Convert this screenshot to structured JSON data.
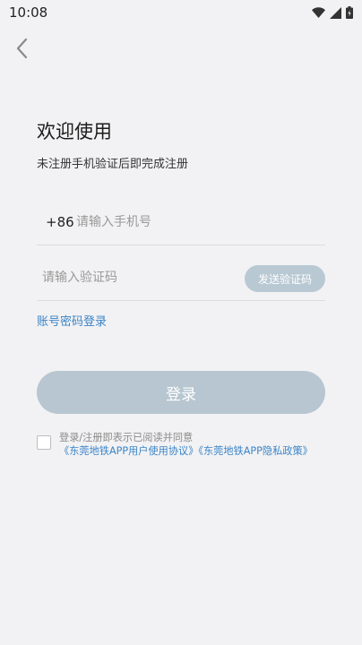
{
  "status_bar": {
    "time": "10:08",
    "icons": [
      "wifi-icon",
      "signal-icon",
      "battery-icon"
    ]
  },
  "nav": {
    "back_icon": "chevron-left-icon"
  },
  "header": {
    "title": "欢迎使用",
    "subtitle": "未注册手机验证后即完成注册"
  },
  "phone": {
    "prefix": "+86",
    "placeholder": "请输入手机号",
    "value": ""
  },
  "code": {
    "placeholder": "请输入验证码",
    "value": "",
    "send_label": "发送验证码"
  },
  "password_login_link": "账号密码登录",
  "login_button": "登录",
  "agreement": {
    "checked": false,
    "prefix": "登录/注册即表示已阅读并同意",
    "user_agreement": "《东莞地铁APP用户使用协议》",
    "privacy_policy": "《东莞地铁APP隐私政策》"
  },
  "colors": {
    "background": "#f2f2f4",
    "link": "#3b84c7",
    "button_disabled": "#b7c6d0",
    "send_button": "#b9c9d3"
  }
}
